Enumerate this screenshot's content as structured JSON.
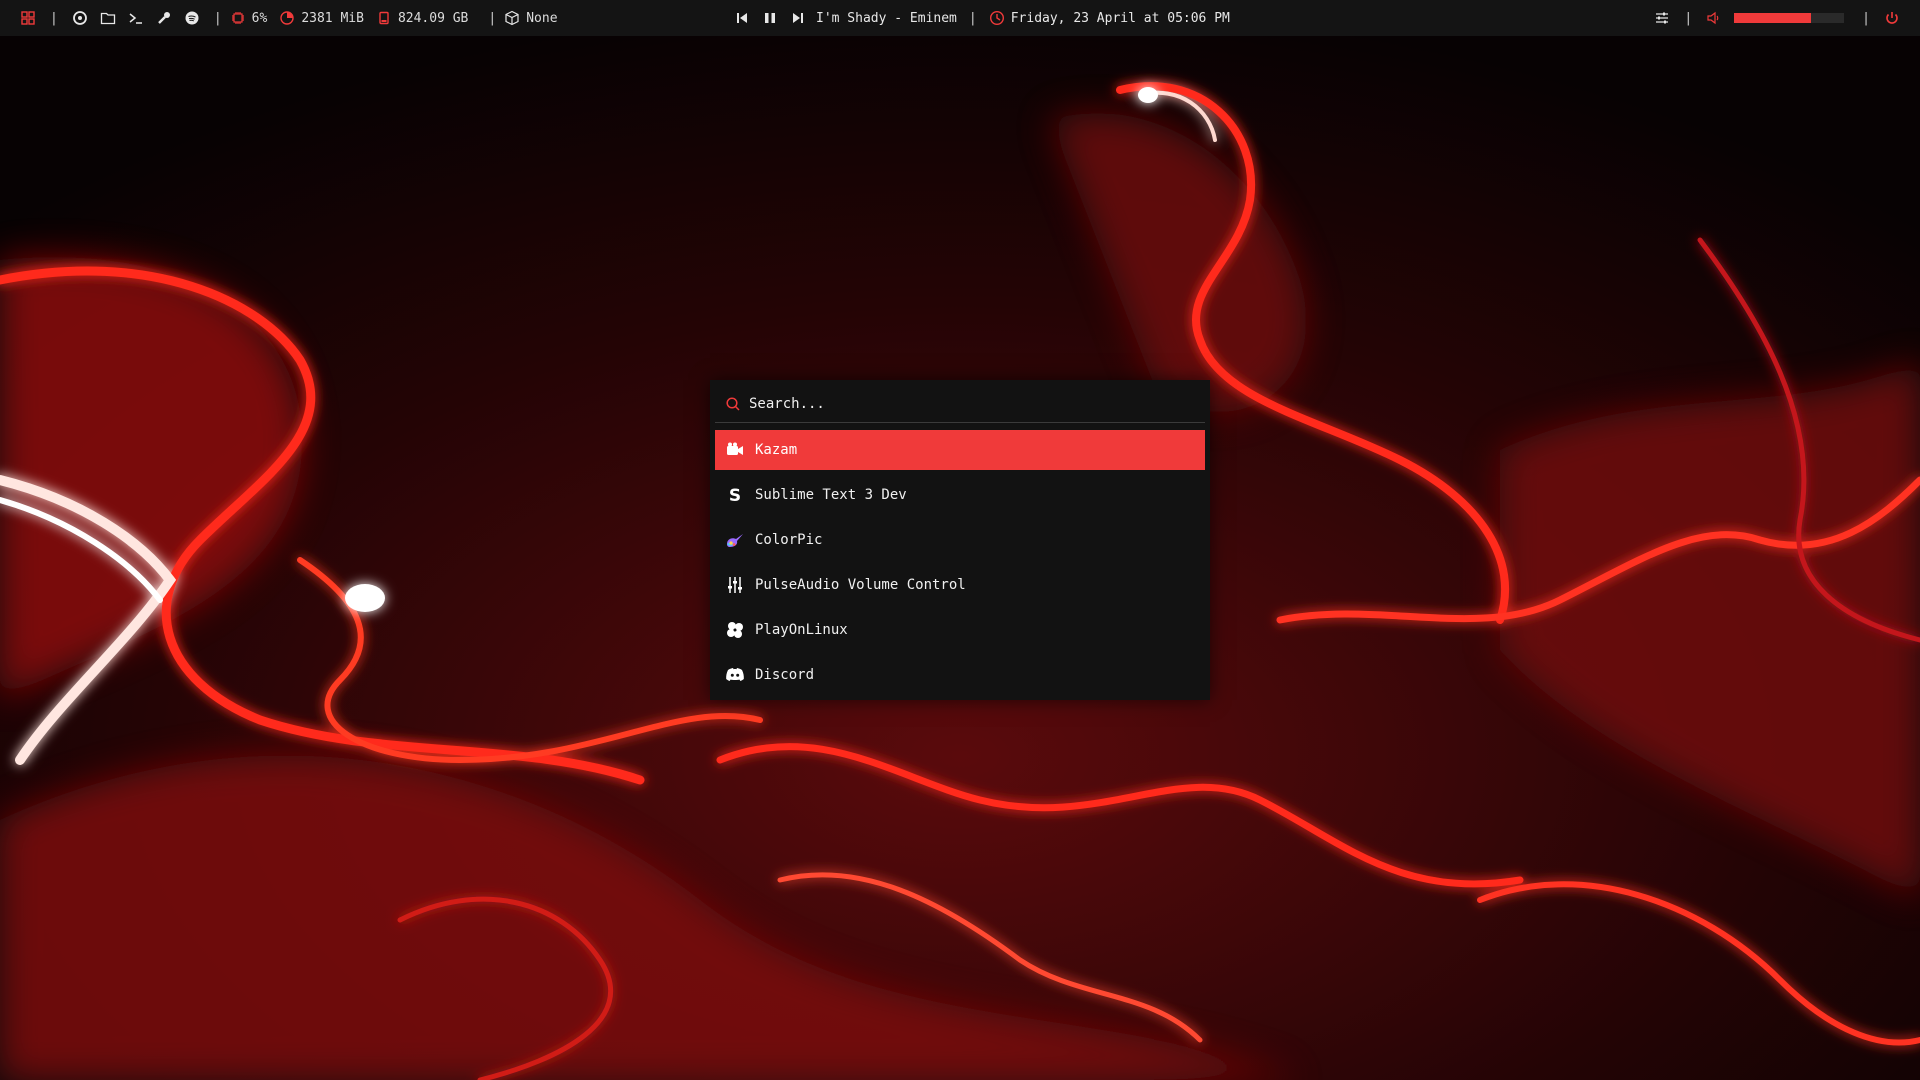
{
  "colors": {
    "accent": "#f03a3a",
    "bar_bg": "#141414",
    "menu_bg": "#121212"
  },
  "topbar": {
    "left_icons": [
      "apps-grid-icon",
      "refresh-icon",
      "folder-icon",
      "terminal-icon",
      "tools-icon",
      "spotify-icon"
    ],
    "cpu": "6%",
    "memory": "2381 MiB",
    "disk": "824.09 GB",
    "updates": "None",
    "player": {
      "now_playing": "I'm Shady - Eminem"
    },
    "datetime": "Friday, 23 April at 05:06 PM",
    "volume_level": 0.7
  },
  "launcher": {
    "search_placeholder": "Search...",
    "items": [
      {
        "label": "Kazam",
        "icon": "video-camera-icon",
        "selected": true
      },
      {
        "label": "Sublime Text 3 Dev",
        "icon": "sublime-s-icon",
        "selected": false
      },
      {
        "label": "ColorPic",
        "icon": "color-palette-icon",
        "selected": false
      },
      {
        "label": "PulseAudio Volume Control",
        "icon": "sliders-icon",
        "selected": false
      },
      {
        "label": "PlayOnLinux",
        "icon": "clover-icon",
        "selected": false
      },
      {
        "label": "Discord",
        "icon": "discord-icon",
        "selected": false
      }
    ]
  }
}
